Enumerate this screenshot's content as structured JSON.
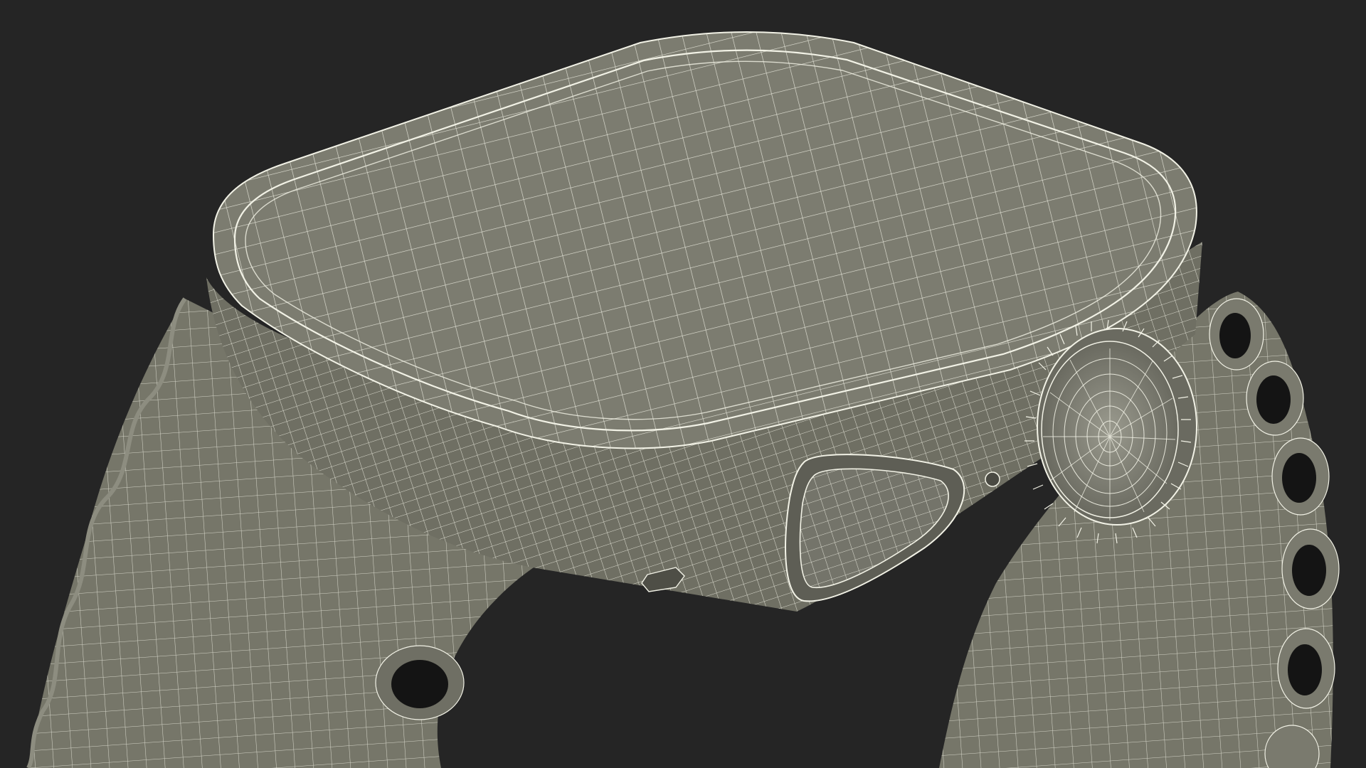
{
  "scene": {
    "subject": "",
    "colors": {
      "background": "#252525",
      "surface": "#7c7c70",
      "surface_light": "#8a8a7e",
      "surface_dark": "#5f5f56",
      "wire": "#f2f2e6",
      "hole": "#141414"
    }
  }
}
